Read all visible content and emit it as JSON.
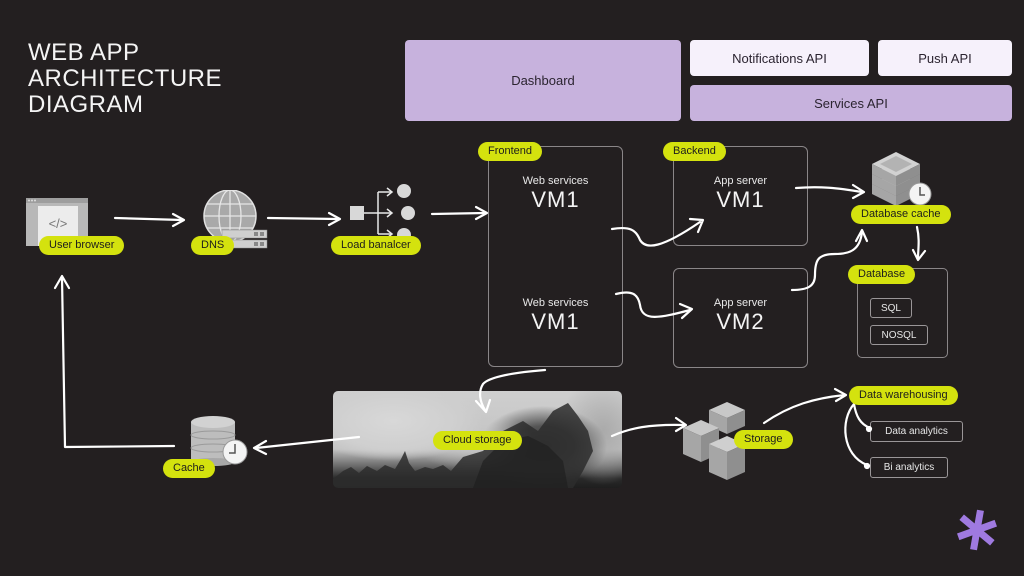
{
  "title": {
    "lines": [
      "WEB APP",
      "ARCHITECTURE",
      "DIAGRAM"
    ]
  },
  "top": {
    "dashboard": "Dashboard",
    "notifications_api": "Notifications API",
    "push_api": "Push API",
    "services_api": "Services API"
  },
  "nodes": {
    "user_browser": "User browser",
    "dns": "DNS",
    "load_balancer": "Load banalcer",
    "database_cache": "Database cache",
    "cloud_storage": "Cloud storage",
    "cache": "Cache",
    "storage": "Storage",
    "data_warehousing": "Data warehousing"
  },
  "frontend": {
    "label": "Frontend",
    "vms": [
      {
        "service": "Web services",
        "name": "VM1"
      },
      {
        "service": "Web services",
        "name": "VM1"
      }
    ]
  },
  "backend": {
    "label": "Backend",
    "vms": [
      {
        "service": "App server",
        "name": "VM1"
      },
      {
        "service": "App server",
        "name": "VM2"
      }
    ]
  },
  "database": {
    "label": "Database",
    "types": [
      "SQL",
      "NOSQL"
    ]
  },
  "analytics": [
    "Data analytics",
    "Bi analytics"
  ],
  "colors": {
    "background": "#231f20",
    "accent_lime": "#d4e20e",
    "accent_purple": "#c7b2dd",
    "logo_purple": "#9f7ae0"
  },
  "icons": {
    "browser": "code-window-icon",
    "dns": "globe-server-icon",
    "load_balancer": "load-balancer-icon",
    "database_cache": "server-stack-clock-icon",
    "cache": "database-clock-icon",
    "storage": "server-cluster-icon",
    "logo": "asterisk-logo-icon"
  }
}
